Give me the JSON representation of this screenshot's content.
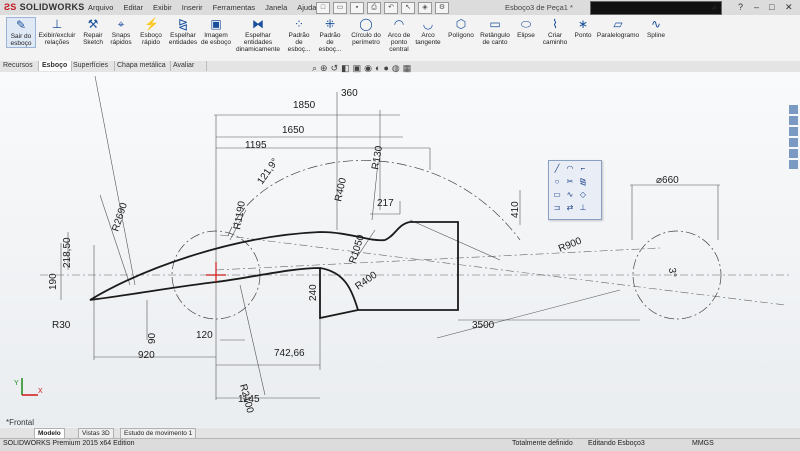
{
  "app": {
    "logo_text": "SOLIDWORKS",
    "document_title": "Esboço3 de Peça1 *"
  },
  "menu": [
    "Arquivo",
    "Editar",
    "Exibir",
    "Inserir",
    "Ferramentas",
    "Janela",
    "Ajuda"
  ],
  "ribbon": {
    "sair_esboco": "Sair do esboço",
    "exibir_excluir": "Exibir/excluir relações",
    "repair_sketch": "Repair Sketch",
    "snaps": "Snaps rápidos",
    "esboco_rapido": "Esboço rápido",
    "espelhar": "Espelhar entidades",
    "imagem": "Imagem de esboço",
    "espelhar_din": "Espelhar entidades dinamicamente",
    "padrao1": "Padrão de esboç...",
    "padrao2": "Padrão de esboç...",
    "circulo_perimetro": "Círculo do perímetro",
    "arco_ponto": "Arco de ponto central",
    "arco_tangente": "Arco tangente",
    "poligono": "Polígono",
    "retangulo": "Retângulo de canto",
    "elipse": "Elipse",
    "criar_caminho": "Criar caminho",
    "ponto": "Ponto",
    "paralelogramo": "Paralelogramo",
    "spline": "Spline"
  },
  "tabs": [
    "Recursos",
    "Esboço",
    "Superfícies",
    "Chapa metálica",
    "Avaliar"
  ],
  "active_tab": "Esboço",
  "view_label": "*Frontal",
  "bottom_tabs": [
    "Modelo",
    "Vistas 3D",
    "Estudo de movimento 1"
  ],
  "status": {
    "edition": "SOLIDWORKS Premium 2015 x64 Edition",
    "defined": "Totalmente definido",
    "editing": "Editando Esboço3",
    "units": "MMGS"
  },
  "dimensions": {
    "d1850": "1850",
    "d360": "360",
    "d1650": "1650",
    "d1195": "1195",
    "a1219": "121,9°",
    "r130": "R130",
    "r1190": "R1190",
    "r2690": "R2690",
    "r400a": "R400",
    "d217": "217",
    "d410": "410",
    "r1050": "R1050",
    "r900": "R900",
    "dia660": "⌀660",
    "d218": "218,50",
    "d190": "190",
    "r30": "R30",
    "d240": "240",
    "r400b": "R400",
    "d3": "3°",
    "d3500": "3500",
    "d90": "90",
    "d120": "120",
    "d920": "920",
    "r2100": "R2100",
    "d742": "742,66",
    "d1145": "1145"
  },
  "colors": {
    "sketch_line": "#1b1b1b",
    "dimension": "#2a2a2a",
    "origin": "#d01818",
    "accent": "#1a4f9c"
  }
}
